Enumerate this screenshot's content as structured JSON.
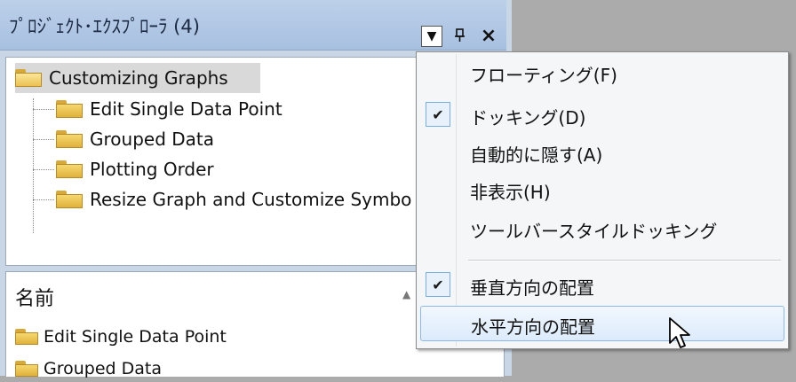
{
  "panel": {
    "title": "ﾌﾟﾛｼﾞｪｸﾄ･ｴｸｽﾌﾟﾛｰﾗ (4)",
    "dropdown_glyph": "▼",
    "pin_glyph": "ᵖ",
    "close_glyph": "×"
  },
  "tree": {
    "root": "Customizing Graphs",
    "children": [
      "Edit Single Data Point",
      "Grouped Data",
      "Plotting Order",
      "Resize Graph and Customize Symbo"
    ]
  },
  "list": {
    "header": "名前",
    "sort_glyph": "▲",
    "items": [
      "Edit Single Data Point",
      "Grouped Data"
    ]
  },
  "menu": {
    "items": [
      {
        "label": "フローティング(F)",
        "checked": false
      },
      {
        "label": "ドッキング(D)",
        "checked": true
      },
      {
        "label": "自動的に隠す(A)",
        "checked": false
      },
      {
        "label": "非表示(H)",
        "checked": false
      },
      {
        "label": "ツールバースタイルドッキング",
        "checked": false
      },
      {
        "label": "垂直方向の配置",
        "checked": true
      },
      {
        "label": "水平方向の配置",
        "checked": false,
        "hovered": true
      }
    ],
    "check_glyph": "✔"
  }
}
